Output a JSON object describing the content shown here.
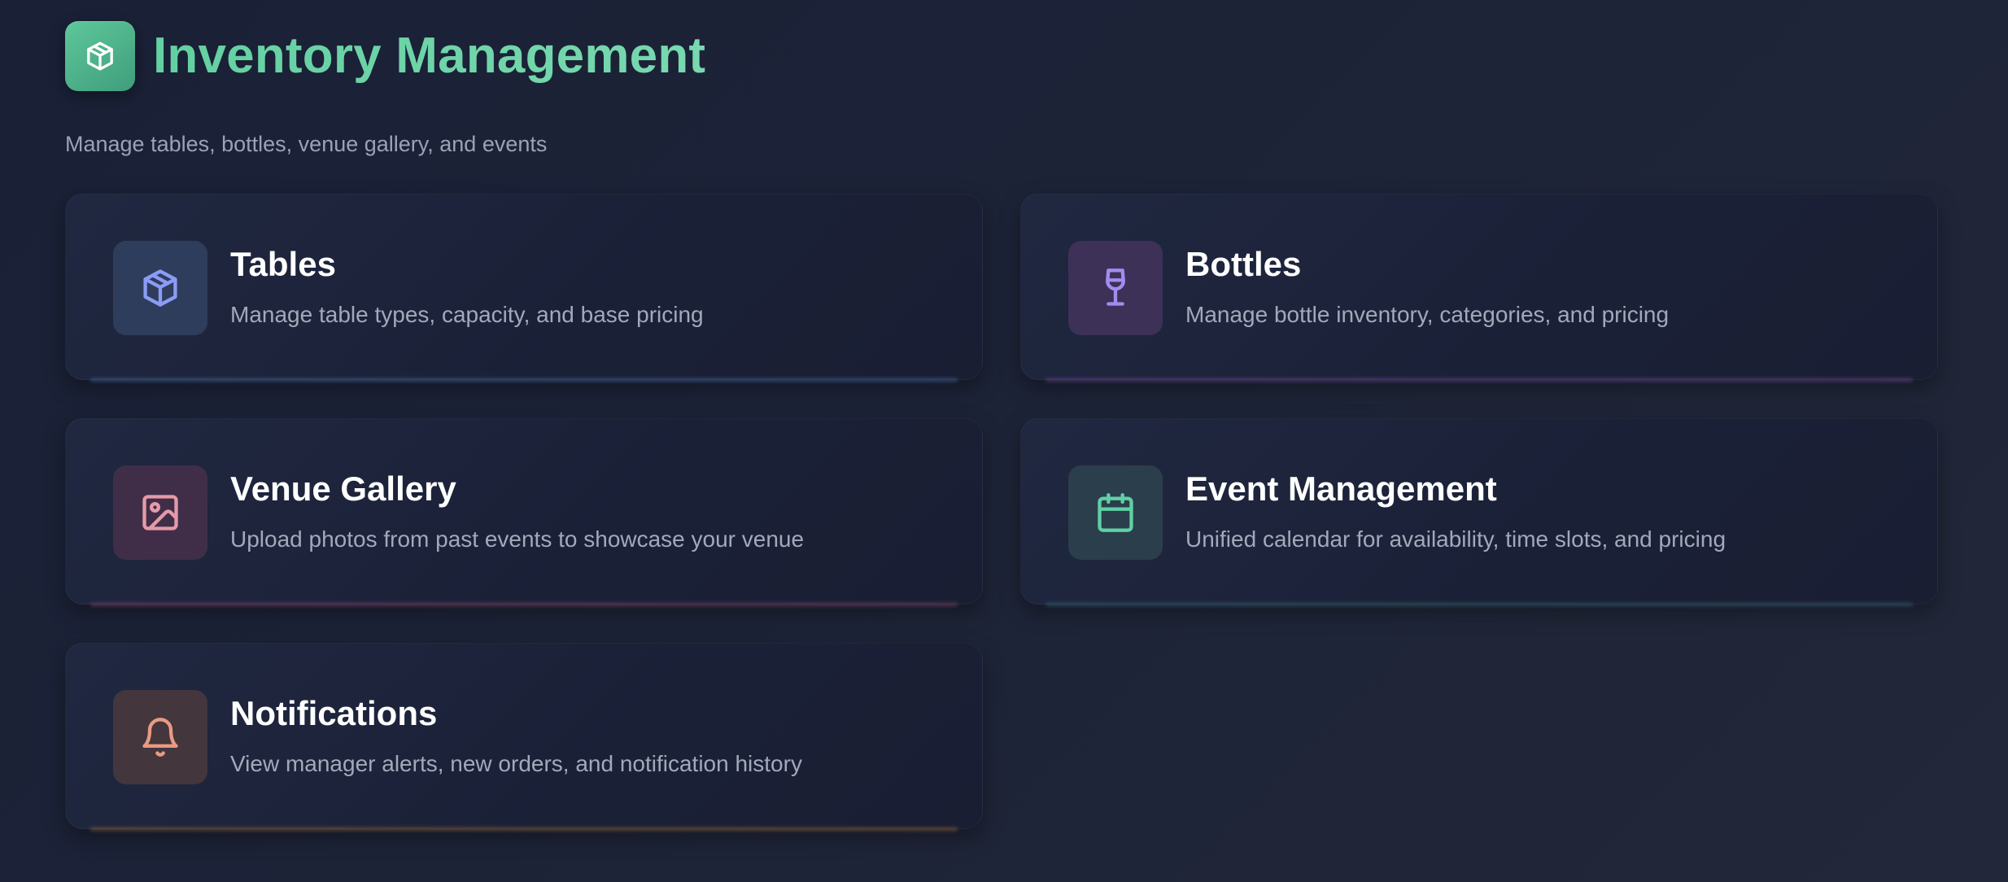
{
  "header": {
    "title": "Inventory Management",
    "subtitle": "Manage tables, bottles, venue gallery, and events",
    "logo_icon": "package-icon"
  },
  "cards": [
    {
      "title": "Tables",
      "description": "Manage table types, capacity, and base pricing",
      "icon": "package-icon",
      "accent": "#8a9cf5"
    },
    {
      "title": "Bottles",
      "description": "Manage bottle inventory, categories, and pricing",
      "icon": "wine-glass-icon",
      "accent": "#a18df0"
    },
    {
      "title": "Venue Gallery",
      "description": "Upload photos from past events to showcase your venue",
      "icon": "image-icon",
      "accent": "#e59aa9"
    },
    {
      "title": "Event Management",
      "description": "Unified calendar for availability, time slots, and pricing",
      "icon": "calendar-icon",
      "accent": "#5fd0a5"
    },
    {
      "title": "Notifications",
      "description": "View manager alerts, new orders, and notification history",
      "icon": "bell-icon",
      "accent": "#e89a82"
    }
  ],
  "colors": {
    "title_gradient_start": "#63d0a1",
    "logo_bg": "#4fb38c",
    "page_bg": "#1d2337"
  }
}
